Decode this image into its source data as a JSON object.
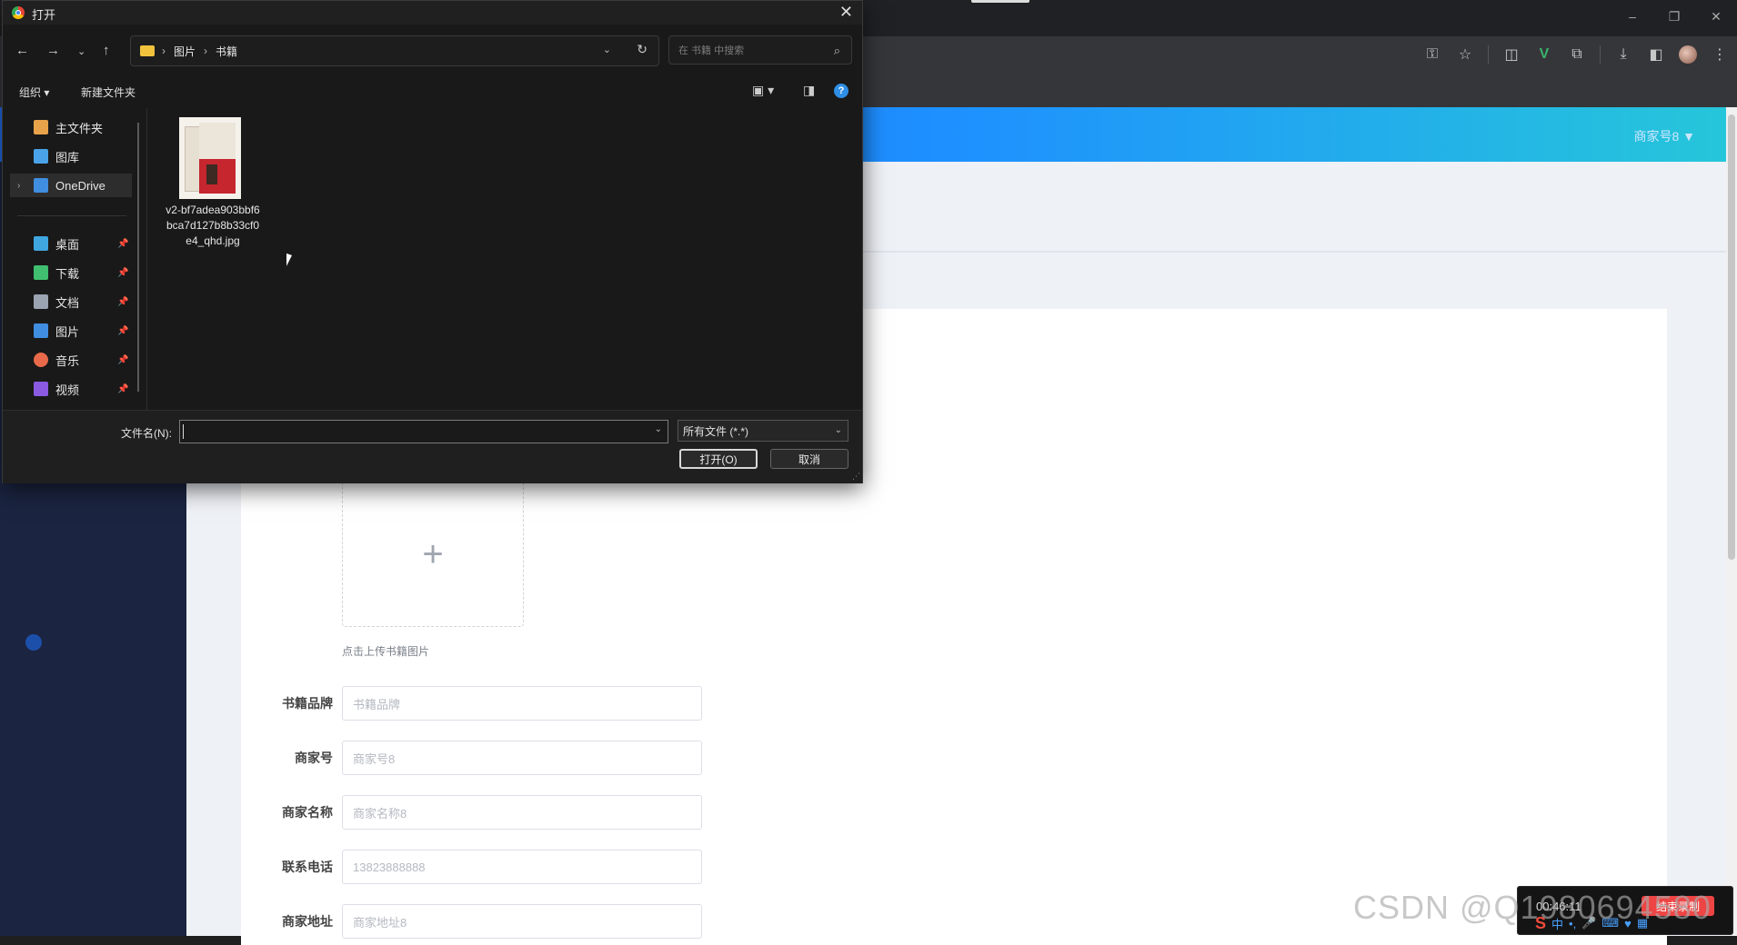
{
  "dialog": {
    "title": "打开",
    "breadcrumbs": [
      "图片",
      "书籍"
    ],
    "search_placeholder": "在 书籍 中搜索",
    "commands": {
      "organize": "组织 ▾",
      "new_folder": "新建文件夹"
    },
    "nav_pane": [
      {
        "label": "主文件夹",
        "icon": "home-icon",
        "color": "#e8a24a"
      },
      {
        "label": "图库",
        "icon": "gallery-icon",
        "color": "#4aa3e8"
      },
      {
        "label": "OneDrive",
        "icon": "onedrive-icon",
        "color": "#3f8ee0"
      },
      {
        "label": "桌面",
        "icon": "desktop-icon",
        "color": "#3fa6e0"
      },
      {
        "label": "下载",
        "icon": "download-icon",
        "color": "#3fbf6f"
      },
      {
        "label": "文档",
        "icon": "document-icon",
        "color": "#9aa3b0"
      },
      {
        "label": "图片",
        "icon": "picture-icon",
        "color": "#3f8ee0"
      },
      {
        "label": "音乐",
        "icon": "music-icon",
        "color": "#e86a4a"
      },
      {
        "label": "视频",
        "icon": "video-icon",
        "color": "#8a5ae0"
      }
    ],
    "files": [
      {
        "name": "v2-bf7adea903bbf6bca7d127b8b33cf0e4_qhd.jpg"
      }
    ],
    "filename_label": "文件名(N):",
    "filename_value": "",
    "filetype": "所有文件 (*.*)",
    "open_label": "打开(O)",
    "cancel_label": "取消"
  },
  "app": {
    "merchant_menu": "商家号8 ▼",
    "upload_hint": "点击上传书籍图片",
    "form": [
      {
        "label": "书籍品牌",
        "placeholder": "书籍品牌"
      },
      {
        "label": "商家号",
        "placeholder": "商家号8"
      },
      {
        "label": "商家名称",
        "placeholder": "商家名称8"
      },
      {
        "label": "联系电话",
        "placeholder": "13823888888"
      },
      {
        "label": "商家地址",
        "placeholder": "商家地址8"
      }
    ]
  },
  "overlay": {
    "watermark": "CSDN @Q1980694580",
    "recorder_time": "00:46:11",
    "recorder_stop": "结束录制"
  },
  "colors": {
    "header_start": "#1e6df2",
    "header_end": "#26c6da",
    "sidebar": "#1b2440",
    "accent": "#2f8fe6"
  }
}
